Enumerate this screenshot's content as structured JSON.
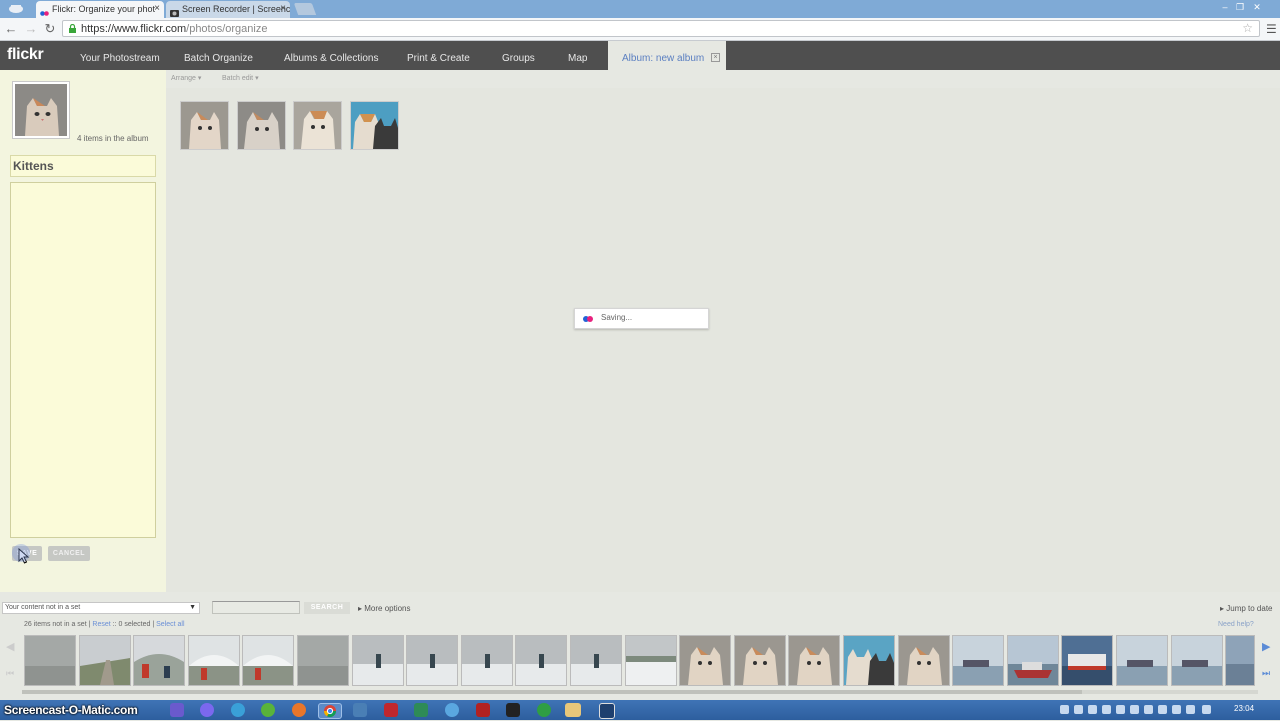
{
  "browser": {
    "tabs": [
      {
        "label": "Flickr: Organize your phot",
        "active": true
      },
      {
        "label": "Screen Recorder | Screenc",
        "active": false
      }
    ],
    "tab_close_glyph": "×",
    "url_host": "https://www.flickr.com",
    "url_path": "/photos/organize",
    "window_buttons": [
      "‒",
      "❐",
      "✕"
    ]
  },
  "flickr": {
    "logo": "flickr",
    "nav": [
      "Your Photostream",
      "Batch Organize",
      "Albums & Collections",
      "Print & Create",
      "Groups",
      "Map"
    ],
    "active_tab": "Album: new album",
    "active_tab_close": "×",
    "subbar": {
      "arrange": "Arrange",
      "batch_edit": "Batch edit"
    },
    "album": {
      "item_count": "4 items in the album",
      "title": "Kittens",
      "description": "",
      "save_label": "SAVE",
      "cancel_label": "CANCEL"
    },
    "album_photos": [
      "kitten-1",
      "kitten-2",
      "kitten-3",
      "kittens-4"
    ],
    "saving_text": "Saving...",
    "filmstrip": {
      "filter": "Your content not in a set",
      "search_label": "SEARCH",
      "more_options": "More options",
      "jump_to_date": "Jump to date",
      "count_text": "26 items not in a set",
      "reset": "Reset",
      "selected_text": "0 selected",
      "select_all": "Select all",
      "need_help": "Need help?",
      "separator": "::",
      "pipe": "|",
      "thumbs": [
        "fog",
        "road",
        "people",
        "greenhouse",
        "greenhouse",
        "fog",
        "skier",
        "skier",
        "skier",
        "skier",
        "skier",
        "snow",
        "kitten",
        "kitten",
        "kitten",
        "kittens",
        "kitten",
        "harbor",
        "ship",
        "ferry",
        "harbor",
        "harbor",
        "partial"
      ]
    }
  },
  "taskbar": {
    "watermark": "Screencast-O-Matic.com",
    "clock": "23:04"
  },
  "colors": {
    "nav_bg": "#4f4f4f",
    "link_blue": "#5b7fc1",
    "panel_yellow": "#f3f5df",
    "flickr_blue": "#2361d6",
    "flickr_pink": "#e8217e"
  }
}
